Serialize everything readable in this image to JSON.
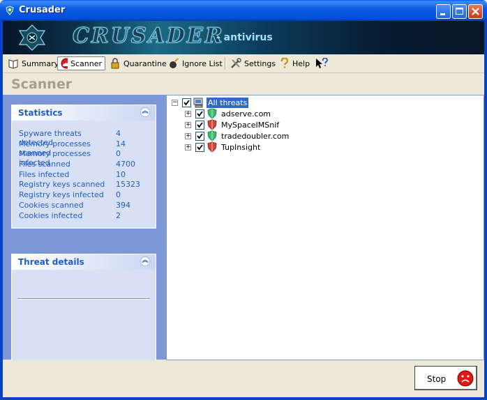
{
  "window": {
    "title": "Crusader"
  },
  "banner": {
    "title": "CRUSADER",
    "subtitle": "- antivirus"
  },
  "toolbar": {
    "items": [
      {
        "label": "Summary",
        "icon": "book-icon"
      },
      {
        "label": "Scanner",
        "icon": "scanner-icon"
      },
      {
        "label": "Quarantine",
        "icon": "lock-icon"
      },
      {
        "label": "Ignore List",
        "icon": "bomb-icon"
      },
      {
        "label": "Settings",
        "icon": "tools-icon"
      },
      {
        "label": "Help",
        "icon": "question-icon"
      }
    ]
  },
  "page": {
    "title": "Scanner"
  },
  "statistics": {
    "title": "Statistics",
    "rows": [
      {
        "label": "Spyware threats detected",
        "value": "4"
      },
      {
        "label": "Memory processes scanned",
        "value": "14"
      },
      {
        "label": "Memory processes infected",
        "value": "0"
      },
      {
        "label": "Files scanned",
        "value": "4700"
      },
      {
        "label": "Files infected",
        "value": "10"
      },
      {
        "label": "Registry keys scanned",
        "value": "15323"
      },
      {
        "label": "Registry keys infected",
        "value": "0"
      },
      {
        "label": "Cookies scanned",
        "value": "394"
      },
      {
        "label": "Cookies infected",
        "value": "2"
      }
    ]
  },
  "threat_details": {
    "title": "Threat details"
  },
  "tree": {
    "root": "All threats",
    "items": [
      {
        "label": "adserve.com",
        "severity": "low",
        "color": "#3fbf6f"
      },
      {
        "label": "MySpaceIMSnif",
        "severity": "high",
        "color": "#e0453a"
      },
      {
        "label": "tradedoubler.com",
        "severity": "low",
        "color": "#3fbf6f"
      },
      {
        "label": "TupInsight",
        "severity": "high",
        "color": "#e0453a"
      }
    ]
  },
  "stop_button": {
    "label": "Stop"
  }
}
